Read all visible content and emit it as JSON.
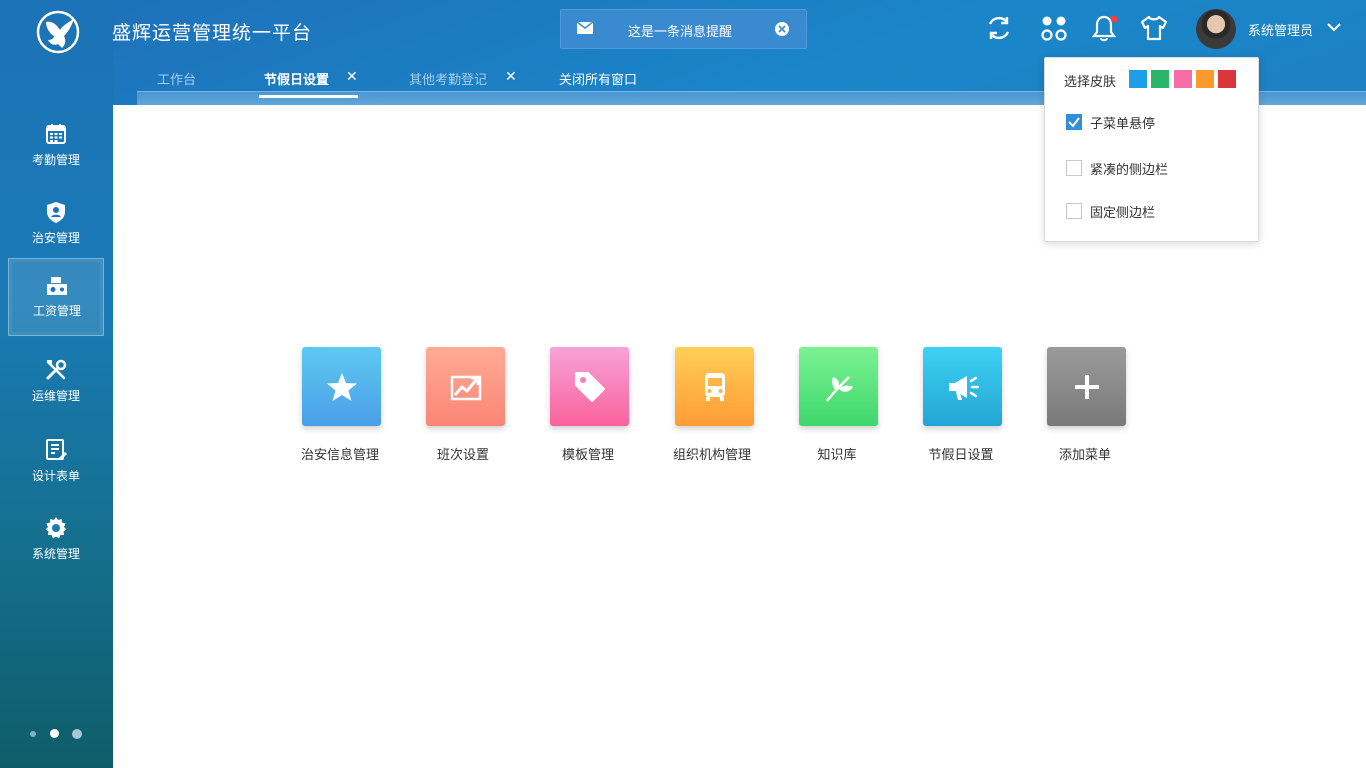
{
  "app": {
    "title": "盛辉运营管理统一平台"
  },
  "notice": {
    "text": "这是一条消息提醒"
  },
  "user": {
    "name": "系统管理员"
  },
  "tabs": [
    {
      "label": "工作台",
      "state": "muted"
    },
    {
      "label": "节假日设置",
      "state": "active",
      "close": "✕"
    },
    {
      "label": "其他考勤登记",
      "state": "muted",
      "close": "✕"
    },
    {
      "label": "关闭所有窗口",
      "state": "normal"
    }
  ],
  "sidebar": {
    "items": [
      {
        "label": "考勤管理",
        "icon": "calendar-icon"
      },
      {
        "label": "治安管理",
        "icon": "shield-user-icon"
      },
      {
        "label": "工资管理",
        "icon": "money-icon",
        "active": true
      },
      {
        "label": "运维管理",
        "icon": "tools-icon"
      },
      {
        "label": "设计表单",
        "icon": "form-edit-icon"
      },
      {
        "label": "系统管理",
        "icon": "gear-icon"
      }
    ]
  },
  "tiles": [
    {
      "label": "治安信息管理",
      "icon": "star-icon",
      "color_top": "#5ec9f0",
      "color_bottom": "#4a9ee8"
    },
    {
      "label": "班次设置",
      "icon": "chart-trend-icon",
      "color_top": "#ffab96",
      "color_bottom": "#fb8575"
    },
    {
      "label": "模板管理",
      "icon": "tag-icon",
      "color_top": "#f7a2d9",
      "color_bottom": "#f9629b"
    },
    {
      "label": "组织机构管理",
      "icon": "bus-icon",
      "color_top": "#ffcf55",
      "color_bottom": "#ff9b36"
    },
    {
      "label": "知识库",
      "icon": "leaf-icon",
      "color_top": "#7cf292",
      "color_bottom": "#3ed76c"
    },
    {
      "label": "节假日设置",
      "icon": "megaphone-icon",
      "color_top": "#3ed1f3",
      "color_bottom": "#22a6d3"
    },
    {
      "label": "添加菜单",
      "icon": "plus-icon",
      "color_top": "#9a9a9a",
      "color_bottom": "#7a7a7a"
    }
  ],
  "dropdown": {
    "skin_label": "选择皮肤",
    "skins": [
      "#1e9ee8",
      "#2ab56a",
      "#f36ea5",
      "#fa9a2c",
      "#d9383b"
    ],
    "options": [
      {
        "label": "子菜单悬停",
        "checked": true
      },
      {
        "label": "紧凑的侧边栏",
        "checked": false
      },
      {
        "label": "固定侧边栏",
        "checked": false
      }
    ]
  }
}
